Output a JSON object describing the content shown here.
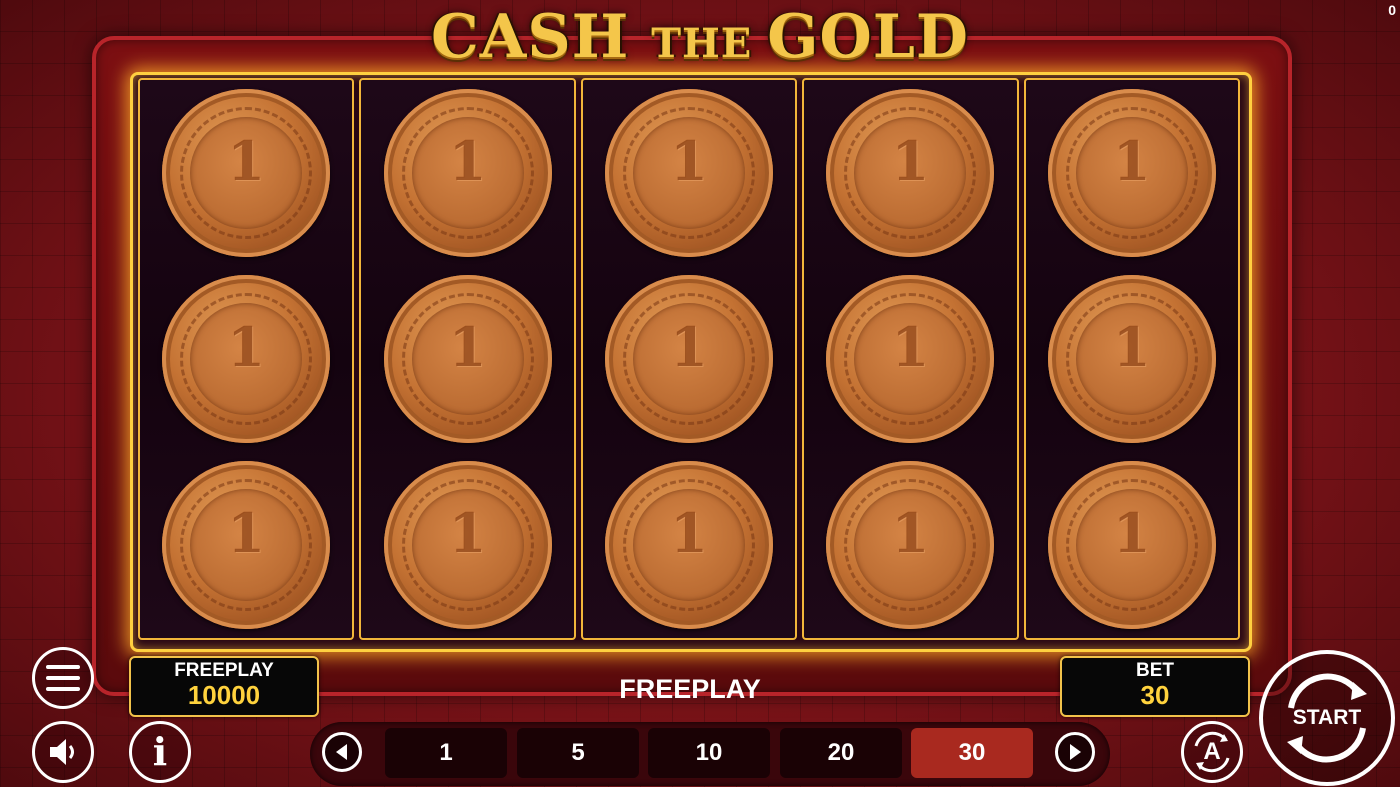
{
  "corner_counter": "0",
  "title": {
    "part1": "CASH ",
    "part2": "THE ",
    "part3": "GOLD"
  },
  "reels": [
    [
      "1",
      "1",
      "1"
    ],
    [
      "1",
      "1",
      "1"
    ],
    [
      "1",
      "1",
      "1"
    ],
    [
      "1",
      "1",
      "1"
    ],
    [
      "1",
      "1",
      "1"
    ]
  ],
  "balance": {
    "label": "FREEPLAY",
    "value": "10000"
  },
  "status_text": "FREEPLAY",
  "bet": {
    "label": "BET",
    "value": "30"
  },
  "bet_options": [
    "1",
    "5",
    "10",
    "20",
    "30"
  ],
  "selected_bet": "30",
  "start_label": "START",
  "auto_icon_letter": "A",
  "info_icon_letter": "i",
  "colors": {
    "gold": "#ffd23d",
    "selected_bet": "#a9291f",
    "background": "#7a1318"
  },
  "icons": [
    "menu-icon",
    "sound-icon",
    "info-icon",
    "prev-arrow-icon",
    "next-arrow-icon",
    "autoplay-icon",
    "spin-icon"
  ]
}
